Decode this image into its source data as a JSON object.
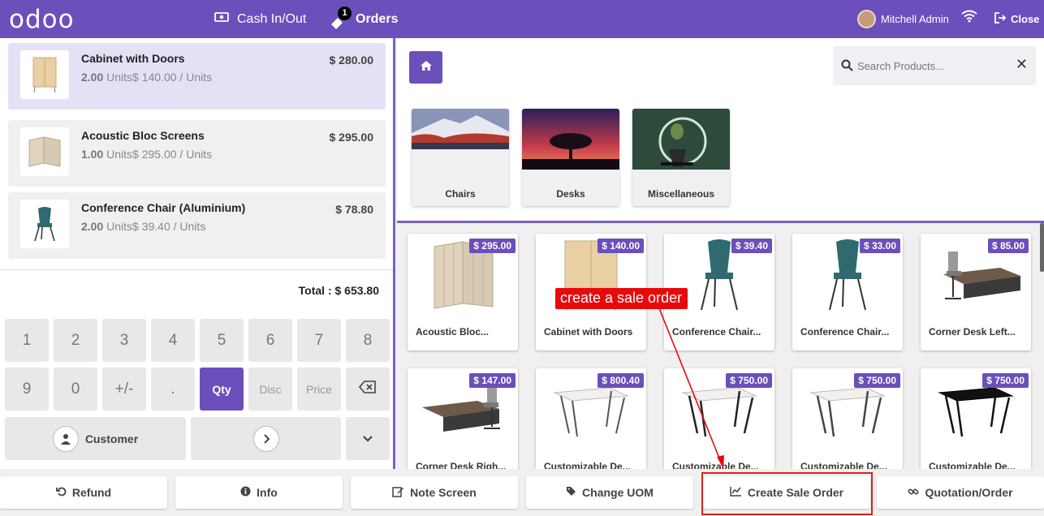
{
  "topbar": {
    "logo": "odoo",
    "cash_label": "Cash In/Out",
    "orders_label": "Orders",
    "orders_count": "1",
    "user_name": "Mitchell Admin",
    "close_label": "Close"
  },
  "order_lines": [
    {
      "name": "Cabinet with Doors",
      "qty": "2.00",
      "unit_text": "Units$ 140.00 / Units",
      "price": "$ 280.00"
    },
    {
      "name": "Acoustic Bloc Screens",
      "qty": "1.00",
      "unit_text": "Units$ 295.00 / Units",
      "price": "$ 295.00"
    },
    {
      "name": "Conference Chair (Aluminium)",
      "qty": "2.00",
      "unit_text": "Units$ 39.40 / Units",
      "price": "$ 78.80"
    }
  ],
  "total": "Total : $ 653.80",
  "numpad": {
    "keys_row1": [
      "1",
      "2",
      "3",
      "4",
      "5",
      "6",
      "7",
      "8"
    ],
    "keys_row2": [
      "9",
      "0",
      "+/-",
      "."
    ],
    "qty": "Qty",
    "disc": "Disc",
    "price": "Price",
    "customer": "Customer"
  },
  "search": {
    "placeholder": "Search Products..."
  },
  "categories": [
    {
      "label": "Chairs"
    },
    {
      "label": "Desks"
    },
    {
      "label": "Miscellaneous"
    }
  ],
  "products": [
    {
      "name": "Acoustic Bloc...",
      "price": "$ 295.00"
    },
    {
      "name": "Cabinet with Doors",
      "price": "$ 140.00"
    },
    {
      "name": "Conference Chair...",
      "price": "$ 39.40"
    },
    {
      "name": "Conference Chair...",
      "price": "$ 33.00"
    },
    {
      "name": "Corner Desk Left...",
      "price": "$ 85.00"
    },
    {
      "name": "Corner Desk Righ...",
      "price": "$ 147.00"
    },
    {
      "name": "Customizable De...",
      "price": "$ 800.40"
    },
    {
      "name": "Customizable De...",
      "price": "$ 750.00"
    },
    {
      "name": "Customizable De...",
      "price": "$ 750.00"
    },
    {
      "name": "Customizable De...",
      "price": "$ 750.00"
    }
  ],
  "bottom": {
    "refund": "Refund",
    "info": "Info",
    "note_screen": "Note Screen",
    "change_uom": "Change UOM",
    "create_sale_order": "Create Sale Order",
    "quotation_order": "Quotation/Order"
  },
  "annotation": "create a sale order",
  "colors": {
    "brand": "#6b4fbb",
    "annotation": "#e8090c"
  }
}
